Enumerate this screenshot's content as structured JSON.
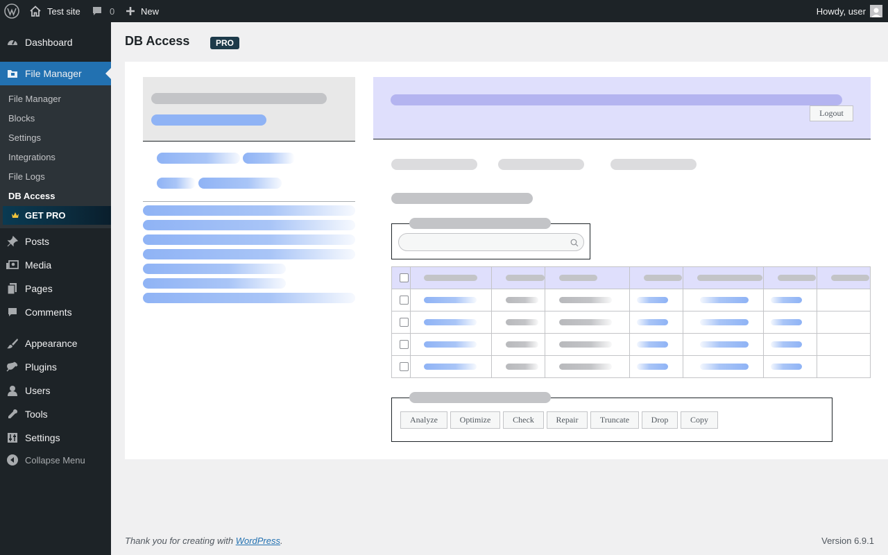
{
  "admin_bar": {
    "site_name": "Test site",
    "comments_count": "0",
    "new_label": "New",
    "howdy": "Howdy, user"
  },
  "page": {
    "title": "DB Access",
    "badge": "PRO"
  },
  "sidebar": {
    "dashboard": "Dashboard",
    "file_manager": "File Manager",
    "submenu": [
      "File Manager",
      "Blocks",
      "Settings",
      "Integrations",
      "File Logs",
      "DB Access"
    ],
    "get_pro": "GET PRO",
    "items": [
      "Posts",
      "Media",
      "Pages",
      "Comments",
      "Appearance",
      "Plugins",
      "Users",
      "Tools",
      "Settings"
    ],
    "collapse": "Collapse Menu"
  },
  "db_panel": {
    "logout_label": "Logout",
    "actions": [
      "Analyze",
      "Optimize",
      "Check",
      "Repair",
      "Truncate",
      "Drop",
      "Copy"
    ]
  },
  "footer": {
    "thanks_prefix": "Thank you for creating with ",
    "thanks_link": "WordPress",
    "thanks_suffix": ".",
    "version": "Version 6.9.1"
  }
}
